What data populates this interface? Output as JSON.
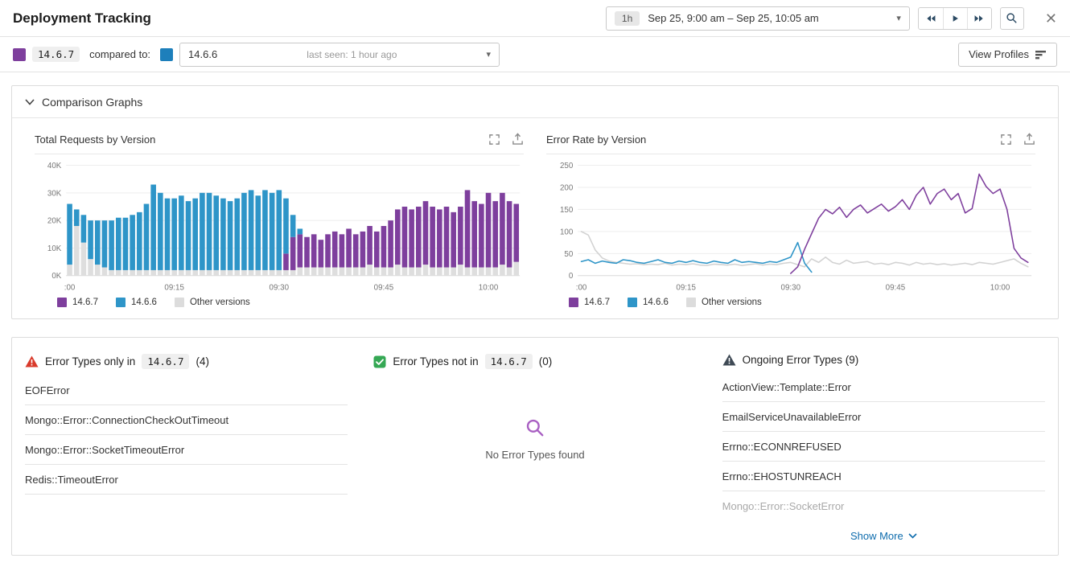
{
  "header": {
    "title": "Deployment Tracking",
    "time_range": {
      "duration": "1h",
      "label": "Sep 25, 9:00 am – Sep 25, 10:05 am"
    }
  },
  "compare_bar": {
    "primary_version": "14.6.7",
    "primary_color": "#7e3f9d",
    "compared_to_label": "compared to:",
    "secondary_color": "#1d7fbb",
    "selected_version": "14.6.6",
    "last_seen": "last seen: 1 hour ago",
    "view_profiles_label": "View Profiles"
  },
  "graphs_panel": {
    "title": "Comparison Graphs"
  },
  "chart_data": [
    {
      "type": "bar",
      "stacked": true,
      "title": "Total Requests by Version",
      "x_start": "09:00",
      "x_step_minutes": 1,
      "x_tick_labels": [
        ":00",
        "09:15",
        "09:30",
        "09:45",
        "10:00"
      ],
      "x_tick_indexes": [
        0,
        15,
        30,
        45,
        60
      ],
      "ylim": [
        0,
        40
      ],
      "y_tick_values": [
        0,
        10,
        20,
        30,
        40
      ],
      "y_tick_labels": [
        "0K",
        "10K",
        "20K",
        "30K",
        "40K"
      ],
      "unit": "thousands of requests per minute",
      "series": [
        {
          "name": "Other versions",
          "color": "#dedede",
          "values": [
            4,
            18,
            12,
            6,
            4,
            3,
            2,
            2,
            2,
            2,
            2,
            2,
            2,
            2,
            2,
            2,
            2,
            2,
            2,
            2,
            2,
            2,
            2,
            2,
            2,
            2,
            2,
            2,
            2,
            2,
            2,
            2,
            2,
            3,
            3,
            3,
            3,
            3,
            3,
            3,
            3,
            3,
            3,
            4,
            3,
            3,
            3,
            4,
            3,
            3,
            3,
            4,
            3,
            3,
            3,
            3,
            4,
            3,
            3,
            3,
            3,
            3,
            4,
            3,
            5
          ]
        },
        {
          "name": "14.6.7",
          "color": "#7e3f9d",
          "values": [
            0,
            0,
            0,
            0,
            0,
            0,
            0,
            0,
            0,
            0,
            0,
            0,
            0,
            0,
            0,
            0,
            0,
            0,
            0,
            0,
            0,
            0,
            0,
            0,
            0,
            0,
            0,
            0,
            0,
            0,
            0,
            6,
            12,
            12,
            11,
            12,
            10,
            12,
            13,
            12,
            14,
            12,
            13,
            14,
            13,
            15,
            17,
            20,
            22,
            21,
            22,
            23,
            22,
            21,
            22,
            20,
            21,
            28,
            24,
            23,
            27,
            24,
            26,
            24,
            21
          ]
        },
        {
          "name": "14.6.6",
          "color": "#2e95c8",
          "values": [
            22,
            6,
            10,
            14,
            16,
            17,
            18,
            19,
            19,
            20,
            21,
            24,
            31,
            28,
            26,
            26,
            27,
            25,
            26,
            28,
            28,
            27,
            26,
            25,
            26,
            28,
            29,
            27,
            29,
            28,
            29,
            20,
            8,
            2,
            0,
            0,
            0,
            0,
            0,
            0,
            0,
            0,
            0,
            0,
            0,
            0,
            0,
            0,
            0,
            0,
            0,
            0,
            0,
            0,
            0,
            0,
            0,
            0,
            0,
            0,
            0,
            0,
            0,
            0,
            0
          ]
        }
      ],
      "legend": [
        {
          "label": "14.6.7",
          "color": "#7e3f9d"
        },
        {
          "label": "14.6.6",
          "color": "#2e95c8"
        },
        {
          "label": "Other versions",
          "color": "#dcdcdc"
        }
      ]
    },
    {
      "type": "line",
      "title": "Error Rate by Version",
      "x_start": "09:00",
      "x_step_minutes": 1,
      "x_tick_labels": [
        ":00",
        "09:15",
        "09:30",
        "09:45",
        "10:00"
      ],
      "x_tick_indexes": [
        0,
        15,
        30,
        45,
        60
      ],
      "ylim": [
        0,
        250
      ],
      "y_tick_values": [
        0,
        50,
        100,
        150,
        200,
        250
      ],
      "y_tick_labels": [
        "0",
        "50",
        "100",
        "150",
        "200",
        "250"
      ],
      "unit": "errors per minute",
      "series": [
        {
          "name": "Other versions",
          "color": "#d2d2d2",
          "values": [
            100,
            92,
            58,
            40,
            33,
            30,
            28,
            26,
            27,
            25,
            26,
            25,
            28,
            24,
            26,
            25,
            27,
            24,
            23,
            26,
            25,
            24,
            26,
            23,
            25,
            27,
            24,
            26,
            25,
            28,
            30,
            25,
            20,
            38,
            30,
            42,
            30,
            26,
            35,
            28,
            30,
            32,
            26,
            28,
            25,
            30,
            28,
            24,
            30,
            26,
            28,
            25,
            27,
            24,
            26,
            28,
            25,
            30,
            28,
            26,
            30,
            34,
            38,
            28,
            20
          ]
        },
        {
          "name": "14.6.6",
          "color": "#2e95c8",
          "values": [
            32,
            36,
            28,
            33,
            30,
            28,
            36,
            34,
            30,
            28,
            32,
            36,
            30,
            28,
            33,
            30,
            34,
            30,
            28,
            33,
            30,
            28,
            36,
            30,
            32,
            30,
            28,
            32,
            30,
            36,
            42,
            75,
            28,
            8,
            null,
            null,
            null,
            null,
            null,
            null,
            null,
            null,
            null,
            null,
            null,
            null,
            null,
            null,
            null,
            null,
            null,
            null,
            null,
            null,
            null,
            null,
            null,
            null,
            null,
            null,
            null,
            null,
            null,
            null,
            null
          ]
        },
        {
          "name": "14.6.7",
          "color": "#7e3f9d",
          "values": [
            null,
            null,
            null,
            null,
            null,
            null,
            null,
            null,
            null,
            null,
            null,
            null,
            null,
            null,
            null,
            null,
            null,
            null,
            null,
            null,
            null,
            null,
            null,
            null,
            null,
            null,
            null,
            null,
            null,
            null,
            5,
            20,
            60,
            95,
            130,
            150,
            140,
            155,
            132,
            150,
            160,
            142,
            152,
            162,
            146,
            156,
            172,
            150,
            182,
            200,
            162,
            186,
            196,
            172,
            186,
            142,
            152,
            230,
            202,
            186,
            196,
            150,
            62,
            40,
            30
          ]
        }
      ],
      "legend": [
        {
          "label": "14.6.7",
          "color": "#7e3f9d"
        },
        {
          "label": "14.6.6",
          "color": "#2e95c8"
        },
        {
          "label": "Other versions",
          "color": "#dcdcdc"
        }
      ]
    }
  ],
  "error_panels": {
    "only_in": {
      "title_prefix": "Error Types only in",
      "version": "14.6.7",
      "count": "(4)",
      "items": [
        "EOFError",
        "Mongo::Error::ConnectionCheckOutTimeout",
        "Mongo::Error::SocketTimeoutError",
        "Redis::TimeoutError"
      ]
    },
    "not_in": {
      "title_prefix": "Error Types not in",
      "version": "14.6.7",
      "count": "(0)",
      "empty_text": "No Error Types found"
    },
    "ongoing": {
      "title": "Ongoing Error Types (9)",
      "items": [
        "ActionView::Template::Error",
        "EmailServiceUnavailableError",
        "Errno::ECONNREFUSED",
        "Errno::EHOSTUNREACH",
        "Mongo::Error::SocketError"
      ],
      "show_more": "Show More"
    }
  }
}
